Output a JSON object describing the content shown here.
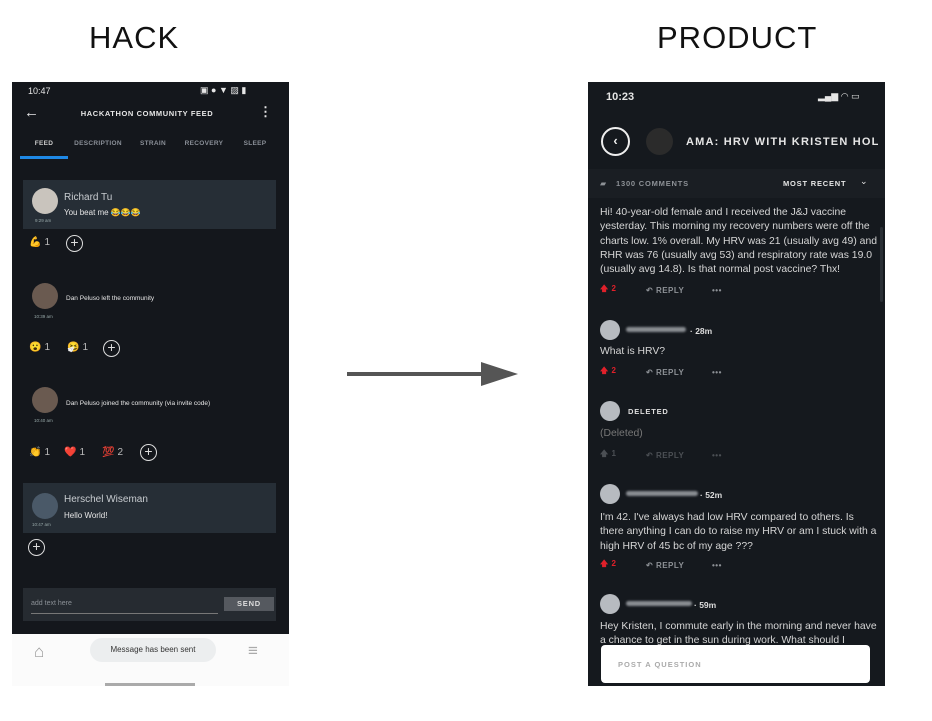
{
  "labels": {
    "left": "HACK",
    "right": "PRODUCT"
  },
  "hack": {
    "status_time": "10:47",
    "title": "HACKATHON COMMUNITY FEED",
    "tabs": [
      "FEED",
      "DESCRIPTION",
      "STRAIN",
      "RECOVERY",
      "SLEEP"
    ],
    "active_tab": "FEED",
    "accent": "#1e88e5",
    "feed": [
      {
        "name": "Richard Tu",
        "message": "You beat me 😂😂😂",
        "time": "9:29 am",
        "reactions": [
          {
            "emoji": "💪",
            "count": "1"
          }
        ]
      },
      {
        "message": "Dan Peluso left the community",
        "time": "10:39 am",
        "reactions": [
          {
            "emoji": "😮",
            "count": "1"
          },
          {
            "emoji": "🤧",
            "count": "1"
          }
        ]
      },
      {
        "message": "Dan Peluso joined the community (via invite code)",
        "time": "10:40 am",
        "reactions": [
          {
            "emoji": "👏",
            "count": "1"
          },
          {
            "emoji": "❤️",
            "count": "1"
          },
          {
            "emoji": "💯",
            "count": "2"
          }
        ]
      },
      {
        "name": "Herschel Wiseman",
        "message": "Hello World!",
        "time": "10:47 am",
        "reactions": []
      }
    ],
    "input_placeholder": "add text here",
    "send_label": "SEND",
    "toast": "Message has been sent"
  },
  "product": {
    "status_time": "10:23",
    "title": "AMA: HRV WITH KRISTEN HOL",
    "comments_count": "1300 COMMENTS",
    "sort": "MOST RECENT",
    "reply_label": "REPLY",
    "vote_color": "#e0202a",
    "comments": [
      {
        "text": "Hi!  40-year-old female and I received the J&J vaccine yesterday. This morning my recovery numbers were off the charts low. 1% overall. My HRV was 21 (usually avg 49) and RHR was 76 (usually avg 53) and respiratory rate was 19.0 (usually avg 14.8).  Is that normal post vaccine?  Thx!",
        "votes": "2"
      },
      {
        "age": "· 28m",
        "text": "What is HRV?",
        "votes": "2"
      },
      {
        "author": "DELETED",
        "text": "(Deleted)",
        "votes": "1"
      },
      {
        "age": "· 52m",
        "text": "I'm 42. I've always had low HRV compared to others. Is there anything I can do to raise my HRV or am I stuck with a high HRV of 45 bc of my age ???",
        "votes": "2"
      },
      {
        "age": "· 59m",
        "text": "Hey Kristen, I commute early in the morning and never have a chance to get in the sun during work. What should I"
      }
    ],
    "post_placeholder": "POST A QUESTION"
  }
}
